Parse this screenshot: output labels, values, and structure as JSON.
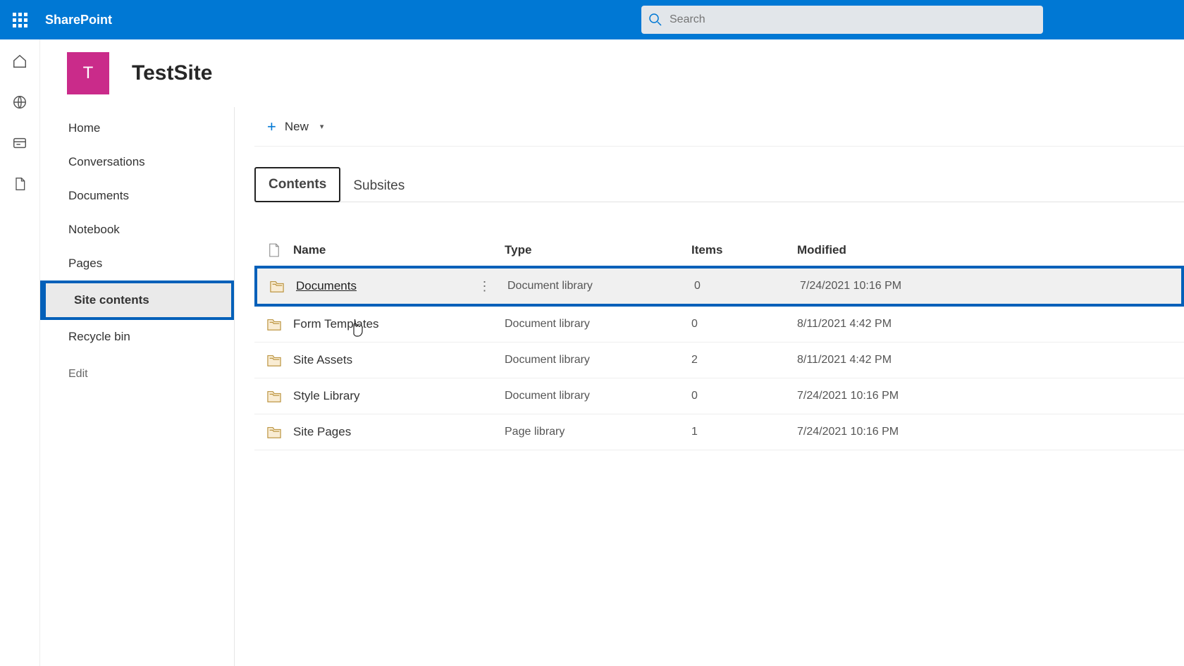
{
  "suite": {
    "app_name": "SharePoint",
    "search_placeholder": "Search"
  },
  "site": {
    "tile_letter": "T",
    "title": "TestSite"
  },
  "sidebar": {
    "items": [
      "Home",
      "Conversations",
      "Documents",
      "Notebook",
      "Pages",
      "Site contents",
      "Recycle bin"
    ],
    "active_index": 5,
    "edit_label": "Edit"
  },
  "command_bar": {
    "new_label": "New"
  },
  "tabs": {
    "items": [
      "Contents",
      "Subsites"
    ],
    "active_index": 0
  },
  "table": {
    "headers": {
      "name": "Name",
      "type": "Type",
      "items": "Items",
      "modified": "Modified"
    },
    "rows": [
      {
        "name": "Documents",
        "type": "Document library",
        "items": "0",
        "modified": "7/24/2021 10:16 PM",
        "hover": true,
        "highlight": true
      },
      {
        "name": "Form Templates",
        "type": "Document library",
        "items": "0",
        "modified": "8/11/2021 4:42 PM"
      },
      {
        "name": "Site Assets",
        "type": "Document library",
        "items": "2",
        "modified": "8/11/2021 4:42 PM"
      },
      {
        "name": "Style Library",
        "type": "Document library",
        "items": "0",
        "modified": "7/24/2021 10:16 PM"
      },
      {
        "name": "Site Pages",
        "type": "Page library",
        "items": "1",
        "modified": "7/24/2021 10:16 PM"
      }
    ]
  }
}
